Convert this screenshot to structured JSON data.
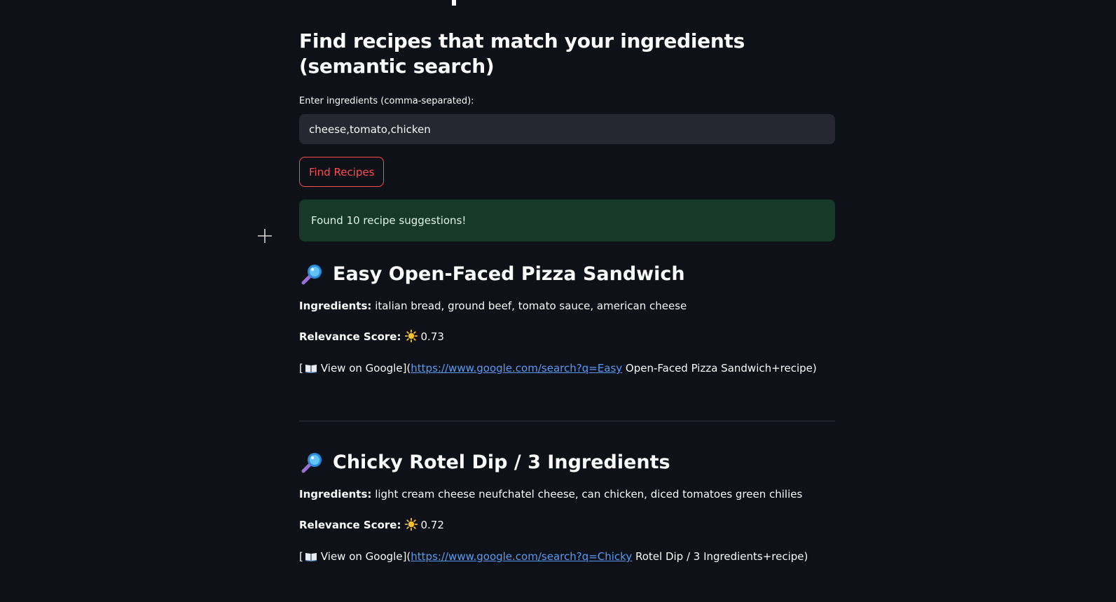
{
  "subtitle": "Find recipes that match your ingredients (semantic search)",
  "input": {
    "label": "Enter ingredients (comma-separated):",
    "value": "cheese,tomato,chicken"
  },
  "button": {
    "label": "Find Recipes"
  },
  "success": {
    "message": "Found 10 recipe suggestions!"
  },
  "labels": {
    "ingredients": "Ingredients:",
    "relevance": "Relevance Score:"
  },
  "recipes": [
    {
      "title": "Easy Open-Faced Pizza Sandwich",
      "ingredients": "italian bread, ground beef, tomato sauce, american cheese",
      "score": "0.73",
      "link_prefix": "[",
      "link_label": "View on Google](",
      "link_url": "https://www.google.com/search?q=Easy",
      "link_suffix": " Open-Faced Pizza Sandwich+recipe)"
    },
    {
      "title": "Chicky Rotel Dip / 3 Ingredients",
      "ingredients": "light cream cheese neufchatel cheese, can chicken, diced tomatoes green chilies",
      "score": "0.72",
      "link_prefix": "[",
      "link_label": "View on Google](",
      "link_url": "https://www.google.com/search?q=Chicky",
      "link_suffix": " Rotel Dip / 3 Ingredients+recipe)"
    }
  ],
  "colors": {
    "background": "#0e1117",
    "input_bg": "#262730",
    "accent": "#ff4b4b",
    "success_bg": "#173928",
    "link": "#5a9bf6"
  },
  "icons": {
    "recipe": "magnifying-glass-icon",
    "score": "sun-icon",
    "link": "open-book-icon",
    "cursor": "crosshair-cursor-icon"
  }
}
